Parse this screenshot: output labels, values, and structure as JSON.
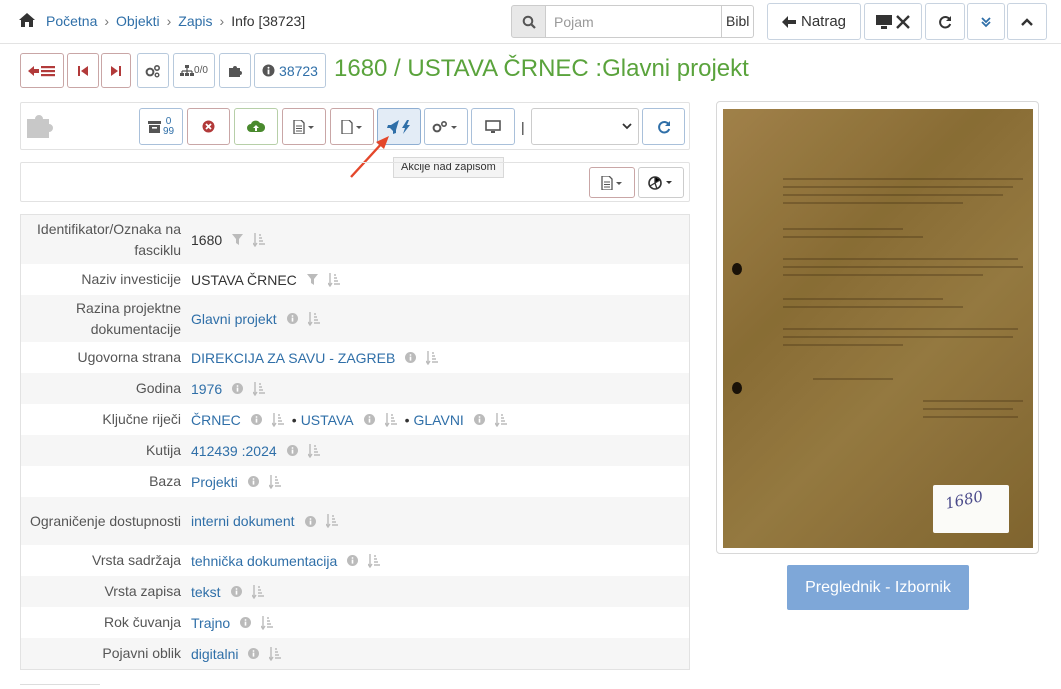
{
  "breadcrumb": {
    "home": "Početna",
    "objects": "Objekti",
    "record": "Zapis",
    "current": "Info [38723]"
  },
  "search": {
    "placeholder": "Pojam",
    "scope": "Bibl"
  },
  "toolbar": {
    "back_label": "Natrag"
  },
  "record": {
    "id_count": "38723",
    "hierarchy_count": "0/0",
    "title": "1680 / USTAVA ČRNEC :Glavni projekt"
  },
  "actions": {
    "counter_top": "0",
    "counter_bottom": "99",
    "tooltip": "Akcije nad zapisom"
  },
  "fields": [
    {
      "label": "Identifikator/Oznaka na fasciklu",
      "value": "1680",
      "link": false
    },
    {
      "label": "Naziv investicije",
      "value": "USTAVA ČRNEC",
      "link": false
    },
    {
      "label": "Razina projektne dokumentacije",
      "value": "Glavni projekt",
      "link": true
    },
    {
      "label": "Ugovorna strana",
      "value": "DIREKCIJA ZA SAVU - ZAGREB",
      "link": true
    },
    {
      "label": "Godina",
      "value": "1976",
      "link": true
    },
    {
      "label": "Ključne riječi",
      "values": [
        "ČRNEC",
        "USTAVA",
        "GLAVNI"
      ],
      "link": true
    },
    {
      "label": "Kutija",
      "value": "412439 :2024",
      "link": true
    },
    {
      "label": "Baza",
      "value": "Projekti",
      "link": true
    },
    {
      "label": "Ograničenje dostupnosti",
      "value": "interni dokument",
      "link": true
    },
    {
      "label": "Vrsta sadržaja",
      "value": "tehnička dokumentacija",
      "link": true
    },
    {
      "label": "Vrsta zapisa",
      "value": "tekst",
      "link": true
    },
    {
      "label": "Rok čuvanja",
      "value": "Trajno",
      "link": true
    },
    {
      "label": "Pojavni oblik",
      "value": "digitalni",
      "link": true
    }
  ],
  "preview": {
    "button_label": "Preglednik - Izbornik",
    "handwritten_note": "1680"
  },
  "colors": {
    "title_green": "#5aa33c",
    "link_blue": "#2f6fa8",
    "preview_button": "#7ea7d8",
    "arrow_red": "#e4472b"
  }
}
